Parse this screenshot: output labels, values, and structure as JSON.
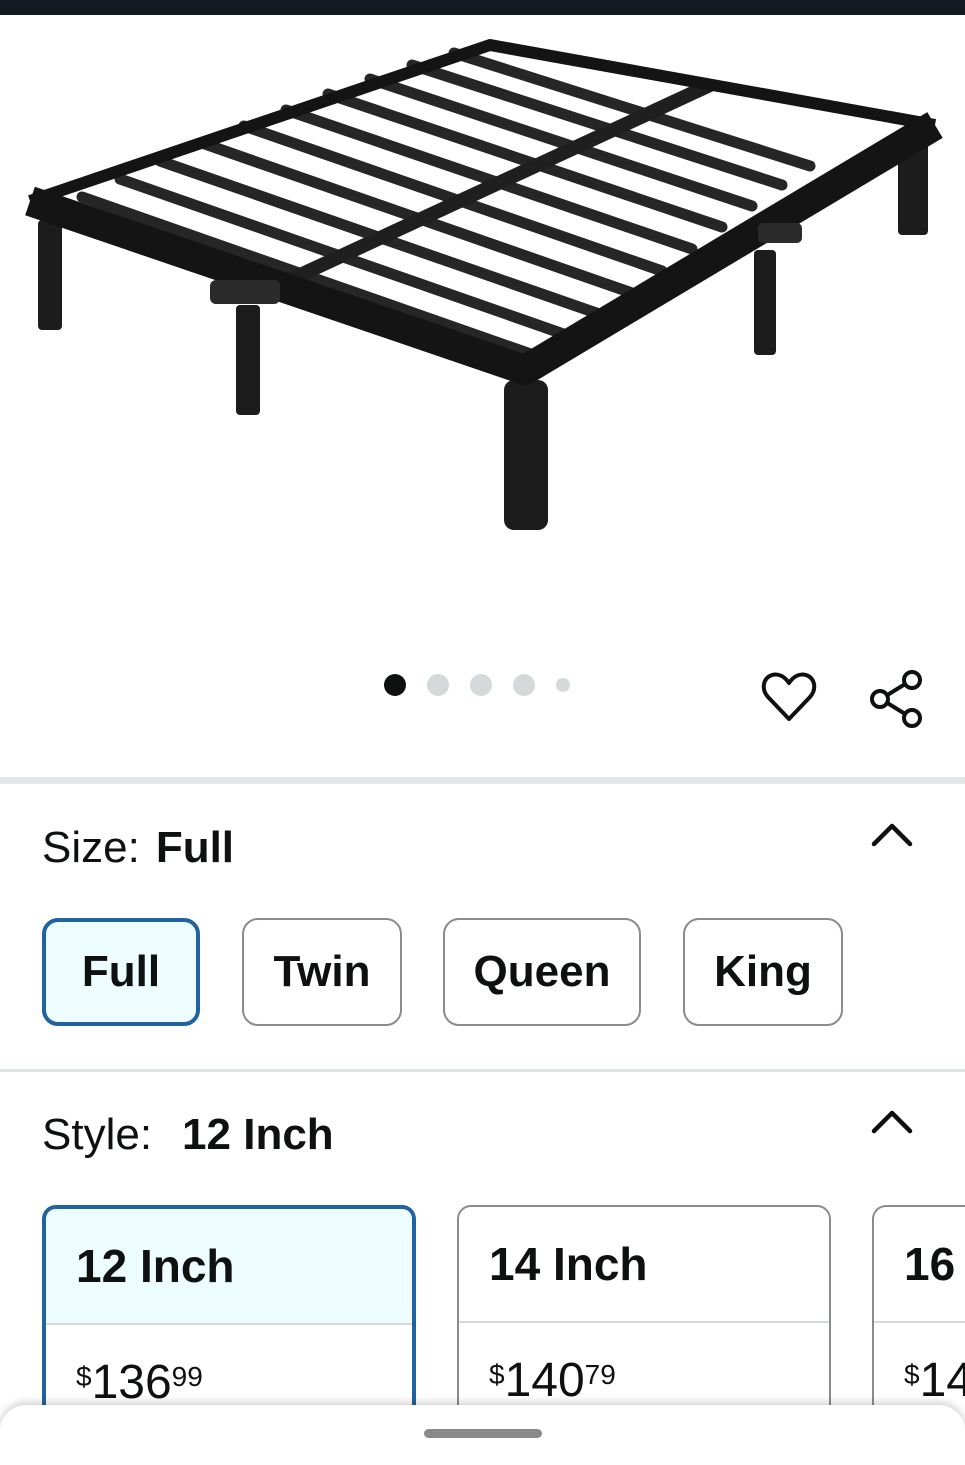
{
  "gallery": {
    "image_alt": "Black metal platform bed frame",
    "image_count": 5,
    "active_index": 0,
    "heart_icon": "heart-icon",
    "share_icon": "share-icon"
  },
  "size": {
    "label": "Size:",
    "selected": "Full",
    "options": [
      "Full",
      "Twin",
      "Queen",
      "King"
    ]
  },
  "style": {
    "label": "Style:",
    "selected": "12 Inch",
    "options": [
      {
        "label": "12 Inch",
        "symbol": "$",
        "whole": "136",
        "fraction": "99"
      },
      {
        "label": "14 Inch",
        "symbol": "$",
        "whole": "140",
        "fraction": "79"
      },
      {
        "label": "16",
        "symbol": "$",
        "whole": "14",
        "fraction": ""
      }
    ]
  },
  "colors": {
    "accent": "#2162a1",
    "selected_bg": "#edfdff",
    "status_bar": "#131a22"
  }
}
